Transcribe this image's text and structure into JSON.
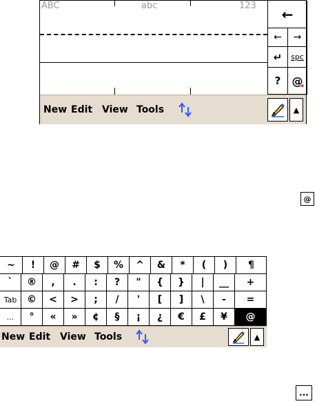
{
  "handwriting_panel": {
    "labels": {
      "upper": "ABC",
      "lower": "abc",
      "numeric": "123"
    },
    "keys": {
      "backspace": "←",
      "left": "←",
      "right": "→",
      "enter": "↵",
      "space": "spc",
      "help": "?",
      "symbols": "@"
    }
  },
  "menubar": {
    "items": [
      "New",
      "Edit",
      "View",
      "Tools"
    ],
    "sip_up": "▲"
  },
  "standalone": {
    "symbols_button": "@",
    "more_button": "..."
  },
  "symbol_keyboard": {
    "rows": [
      [
        "~",
        "!",
        "@",
        "#",
        "$",
        "%",
        "^",
        "&",
        "*",
        "(",
        ")",
        "¶"
      ],
      [
        "`",
        "®",
        ",",
        ".",
        ":",
        "?",
        "\"",
        "{",
        "}",
        "|",
        "__",
        "+"
      ],
      [
        "Tab",
        "©",
        "<",
        ">",
        ";",
        "/",
        "'",
        "[",
        "]",
        "\\",
        "-",
        "="
      ],
      [
        "...",
        "°",
        "«",
        "»",
        "¢",
        "§",
        "¡",
        "¿",
        "€",
        "£",
        "¥",
        "@"
      ]
    ]
  }
}
